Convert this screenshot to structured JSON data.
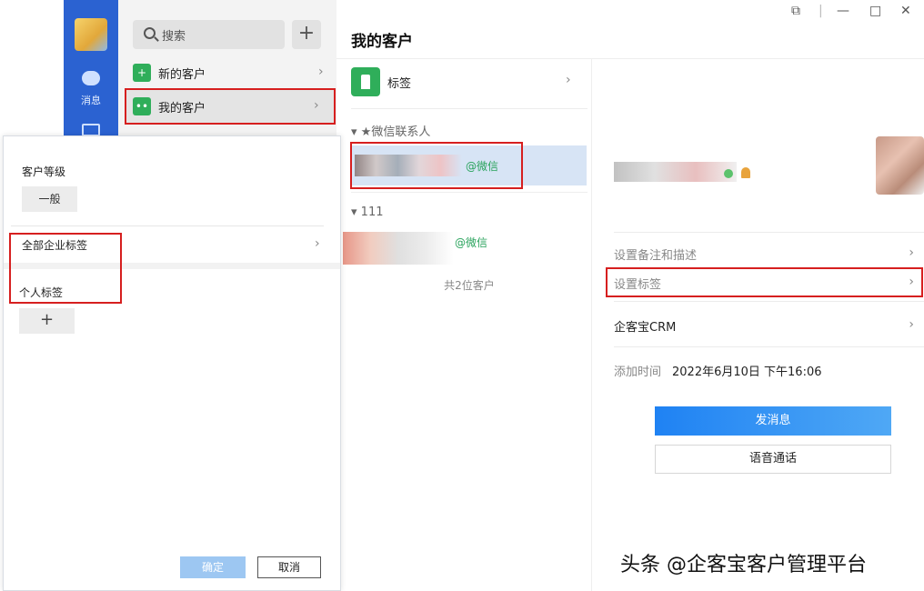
{
  "app": {
    "rail": {
      "messages_label": "消息"
    },
    "list": {
      "search_placeholder": "搜索",
      "add_symbol": "+",
      "items": [
        {
          "label": "新的客户"
        },
        {
          "label": "我的客户"
        }
      ]
    }
  },
  "dialog": {
    "grade_title": "客户等级",
    "grade_value": "一般",
    "corp_tags_label": "全部企业标签",
    "personal_tags_label": "个人标签",
    "add_symbol": "+",
    "ok_label": "确定",
    "cancel_label": "取消"
  },
  "customers": {
    "title": "我的客户",
    "tag_row_label": "标签",
    "groups": [
      {
        "name": "★微信联系人",
        "contact_suffix": "@微信"
      },
      {
        "name": "111",
        "contact_suffix": "@微信"
      }
    ],
    "count_text": "共2位客户"
  },
  "detail": {
    "rows": {
      "remark": "设置备注和描述",
      "set_tags": "设置标签",
      "crm": "企客宝CRM"
    },
    "add_time_label": "添加时间",
    "add_time_value": "2022年6月10日 下午16:06",
    "send_message": "发消息",
    "voice_call": "语音通话"
  },
  "watermark": "头条 @企客宝客户管理平台",
  "colors": {
    "rail": "#2b62d1",
    "accent_blue": "#1f82f3",
    "wechat_green": "#29a35c",
    "highlight_red": "#d61f1f"
  },
  "icons": {
    "rail": [
      "avatar",
      "message-icon",
      "mail-icon"
    ],
    "window": [
      "restore-icon",
      "minimize-icon",
      "maximize-icon",
      "close-icon"
    ]
  }
}
